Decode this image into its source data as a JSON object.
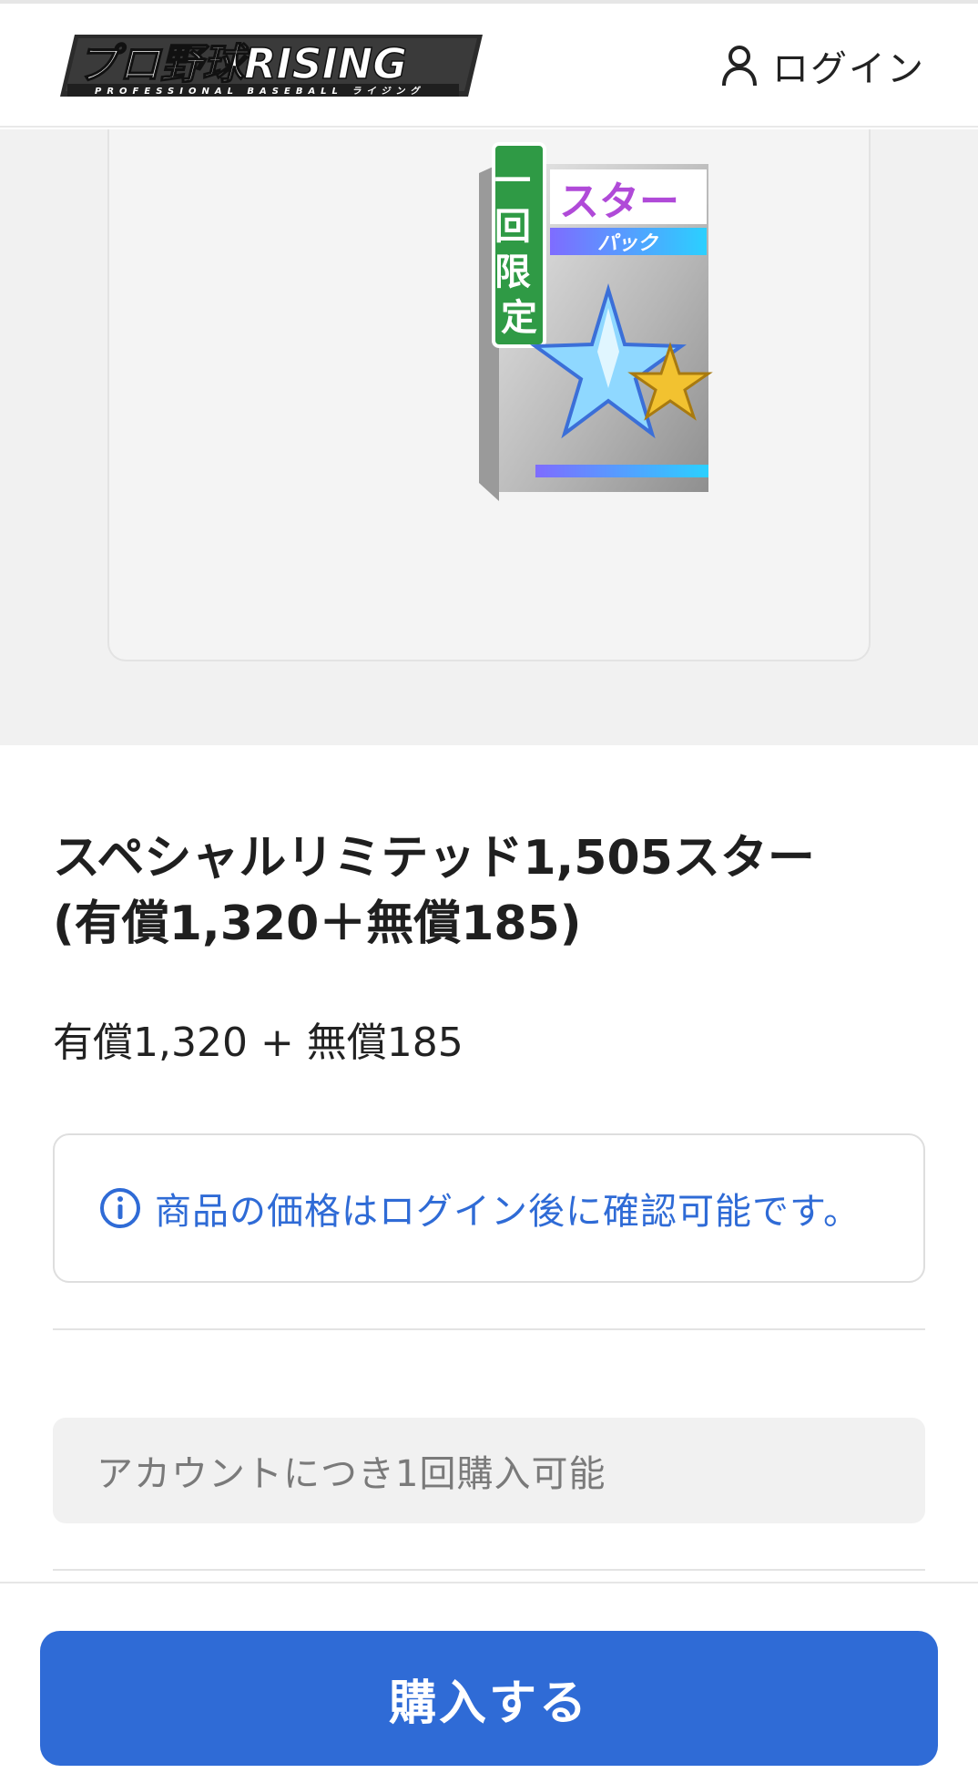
{
  "header": {
    "logo_text": "プロ野球RISING",
    "logo_subtext": "PROFESSIONAL BASEBALL ライジング",
    "login_label": "ログイン"
  },
  "product": {
    "art_badge": "一回限定",
    "art_title": "スター",
    "art_subtitle": "パック",
    "title_line1": "スペシャルリミテッド1,505スター",
    "title_line2": "(有償1,320＋無償185)",
    "subtitle": "有償1,320 + 無償185"
  },
  "notice": {
    "icon": "info-icon",
    "text": "商品の価格はログイン後に確認可能です。"
  },
  "limit": {
    "text": "アカウントにつき1回購入可能"
  },
  "footer": {
    "buy_label": "購入する"
  },
  "colors": {
    "accent": "#2f6bd6",
    "hero_bg": "#f1f1f1"
  }
}
